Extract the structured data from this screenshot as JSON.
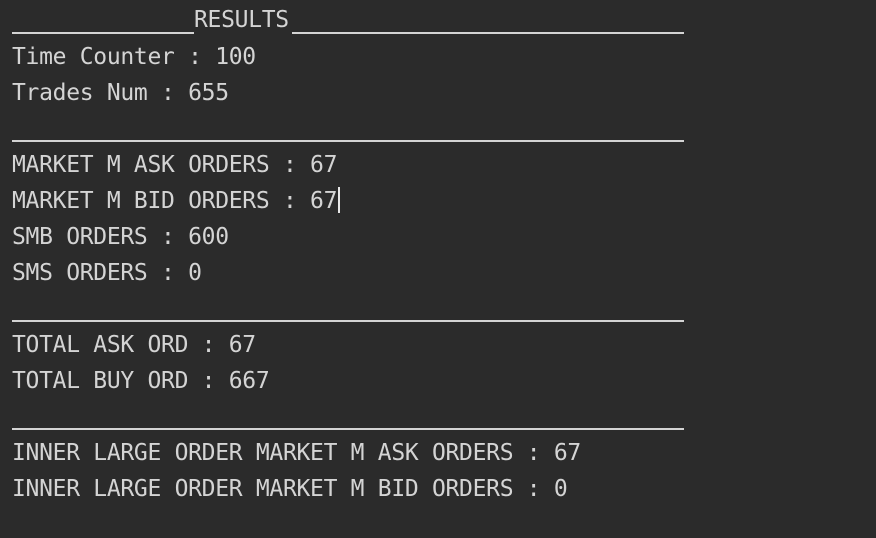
{
  "header": {
    "title": "RESULTS"
  },
  "section_summary": {
    "time_counter": "Time Counter : 100",
    "trades_num": "Trades Num : 655"
  },
  "section_orders": {
    "market_ask": "MARKET M ASK ORDERS : 67",
    "market_bid": "MARKET M BID ORDERS : 67",
    "smb": "SMB ORDERS : 600",
    "sms": "SMS ORDERS : 0"
  },
  "section_totals": {
    "total_ask": "TOTAL ASK ORD : 67",
    "total_buy": "TOTAL BUY ORD : 667"
  },
  "section_inner": {
    "inner_ask": "INNER LARGE ORDER MARKET M ASK ORDERS : 67",
    "inner_bid": "INNER LARGE ORDER MARKET M BID ORDERS : 0"
  }
}
